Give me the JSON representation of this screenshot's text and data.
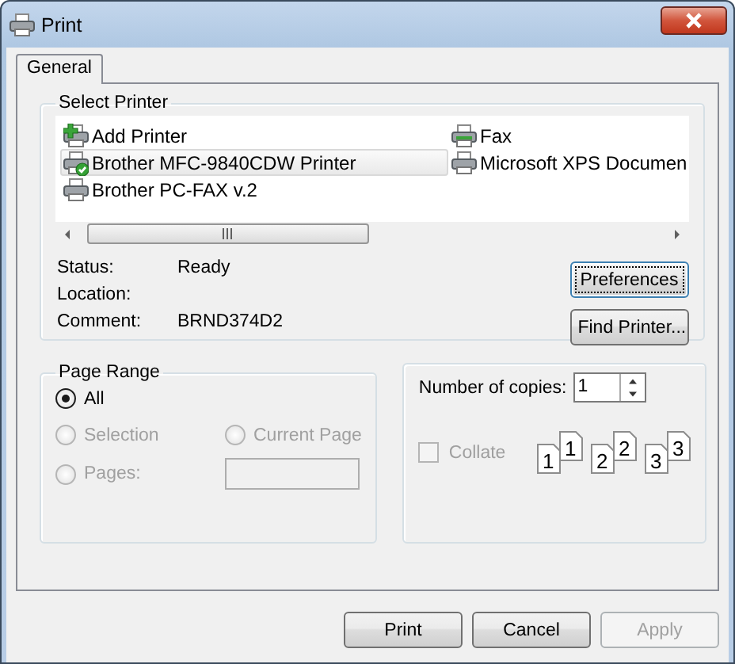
{
  "window": {
    "title": "Print"
  },
  "tabs": [
    {
      "label": "General",
      "selected": true
    }
  ],
  "select_printer": {
    "title": "Select Printer",
    "printers": [
      {
        "name": "Add Printer",
        "kind": "add",
        "selected": false
      },
      {
        "name": "Brother MFC-9840CDW Printer",
        "kind": "default",
        "selected": true
      },
      {
        "name": "Brother PC-FAX v.2",
        "kind": "printer",
        "selected": false
      },
      {
        "name": "Fax",
        "kind": "fax",
        "selected": false
      },
      {
        "name": "Microsoft XPS Documen",
        "kind": "printer",
        "selected": false
      }
    ],
    "details": [
      {
        "label": "Status:",
        "value": "Ready"
      },
      {
        "label": "Location:"
      },
      {
        "label": "Comment:",
        "value": "BRND374D2"
      }
    ],
    "buttons": [
      {
        "label": "Preferences",
        "focused": true
      },
      {
        "label": "Find Printer...",
        "focused": false
      }
    ]
  },
  "page_range": {
    "title": "Page Range",
    "options": [
      {
        "label": "All",
        "selected": true,
        "disabled": false
      },
      {
        "label": "Selection",
        "selected": false,
        "disabled": true
      },
      {
        "label": "Current Page",
        "selected": false,
        "disabled": true
      },
      {
        "label": "Pages:",
        "selected": false,
        "disabled": true
      }
    ],
    "pages_field": {
      "disabled": true
    }
  },
  "copies": {
    "label": "Number of copies:",
    "value": "1",
    "collate": {
      "label": "Collate",
      "checked": false,
      "disabled": true
    },
    "collate_pages": [
      [
        "1",
        "1"
      ],
      [
        "2",
        "2"
      ],
      [
        "3",
        "3"
      ]
    ]
  },
  "buttons": [
    {
      "label": "Print",
      "disabled": false
    },
    {
      "label": "Cancel",
      "disabled": false
    },
    {
      "label": "Apply",
      "disabled": true
    }
  ]
}
